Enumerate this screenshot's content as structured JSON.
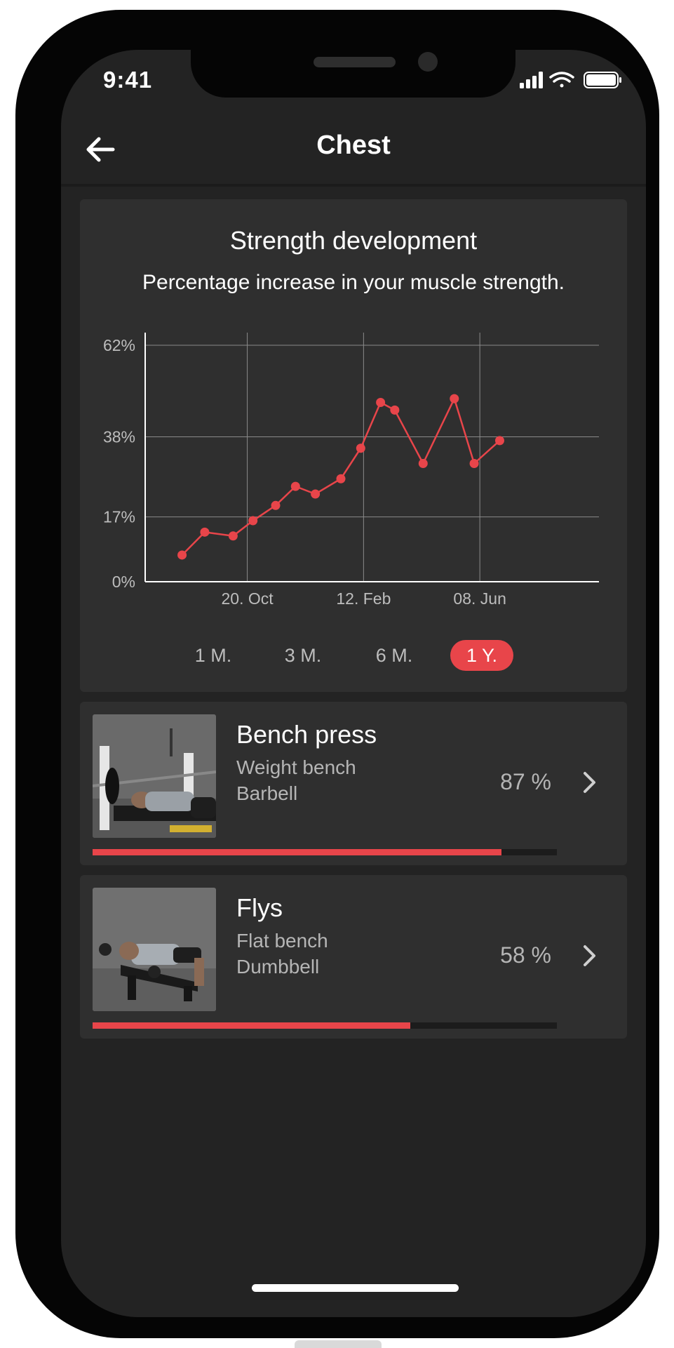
{
  "status_bar": {
    "time": "9:41"
  },
  "header": {
    "title": "Chest"
  },
  "chart_card": {
    "title": "Strength development",
    "subtitle": "Percentage increase in your muscle strength.",
    "periods": [
      "1 M.",
      "3 M.",
      "6 M.",
      "1 Y."
    ],
    "active_period": "1 Y."
  },
  "chart_data": {
    "type": "line",
    "title": "Strength development",
    "subtitle": "Percentage increase in your muscle strength.",
    "y_ticks": [
      "0%",
      "17%",
      "38%",
      "62%"
    ],
    "x_ticks": [
      "20. Oct",
      "12. Feb",
      "08. Jun"
    ],
    "y_tick_values": [
      0,
      17,
      38,
      62
    ],
    "x_tick_positions_index": [
      3.6,
      7.7,
      11.8
    ],
    "series": [
      {
        "values": [
          7,
          13,
          12,
          16,
          20,
          25,
          23,
          27,
          35,
          47,
          45,
          31,
          48,
          31,
          37
        ]
      }
    ],
    "x_index": [
      1.3,
      2.1,
      3.1,
      3.8,
      4.6,
      5.3,
      6.0,
      6.9,
      7.6,
      8.3,
      8.8,
      9.8,
      10.9,
      11.6,
      12.5
    ],
    "x_range": [
      0,
      16
    ],
    "ylim": [
      0,
      62
    ],
    "grid": true,
    "line_color": "#e8454a"
  },
  "exercises": [
    {
      "name": "Bench press",
      "equipment": "Weight bench",
      "tool": "Barbell",
      "percent_label": "87 %",
      "progress": 0.88
    },
    {
      "name": "Flys",
      "equipment": "Flat bench",
      "tool": "Dumbbell",
      "percent_label": "58 %",
      "progress": 0.685
    }
  ],
  "colors": {
    "accent": "#e8454a",
    "background": "#232323",
    "card": "#2f2f2f"
  }
}
